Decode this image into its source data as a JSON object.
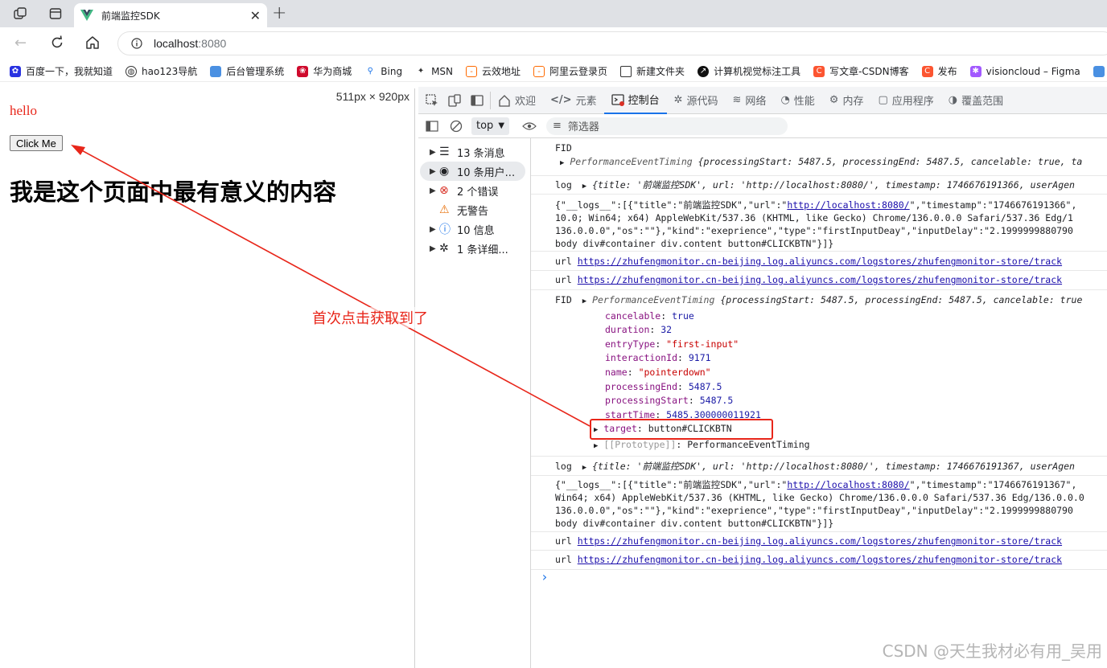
{
  "browser": {
    "tab_title": "前端监控SDK",
    "url_host": "localhost",
    "url_port": ":8080",
    "new_tab_label": "+",
    "viewport_size": "511px × 920px"
  },
  "bookmarks": [
    {
      "label": "百度一下，我就知道",
      "color": "#2932e1",
      "icon": "paw-icon"
    },
    {
      "label": "hao123导航",
      "color": "#555",
      "icon": "globe-icon"
    },
    {
      "label": "后台管理系统",
      "color": "#4a90e2",
      "icon": "doc-icon"
    },
    {
      "label": "华为商城",
      "color": "#cf0a2c",
      "icon": "huawei-icon"
    },
    {
      "label": "Bing",
      "color": "#1a73e8",
      "icon": "search-icon"
    },
    {
      "label": "MSN",
      "color": "#333",
      "icon": "msn-icon"
    },
    {
      "label": "云效地址",
      "color": "#ff6a00",
      "icon": "aliyun-icon"
    },
    {
      "label": "阿里云登录页",
      "color": "#ff6a00",
      "icon": "aliyun-icon"
    },
    {
      "label": "新建文件夹",
      "color": "#555",
      "icon": "folder-icon"
    },
    {
      "label": "计算机视觉标注工具",
      "color": "#111",
      "icon": "arrow-icon"
    },
    {
      "label": "写文章-CSDN博客",
      "color": "#fc5531",
      "icon": "csdn-icon"
    },
    {
      "label": "发布",
      "color": "#fc5531",
      "icon": "csdn-icon"
    },
    {
      "label": "visioncloud – Figma",
      "color": "#a259ff",
      "icon": "figma-icon"
    }
  ],
  "page": {
    "hello": "hello",
    "button_label": "Click Me",
    "heading": "我是这个页面中最有意义的内容",
    "annotation": "首次点击获取到了"
  },
  "devtools": {
    "tabs": [
      "欢迎",
      "元素",
      "控制台",
      "源代码",
      "网络",
      "性能",
      "内存",
      "应用程序",
      "覆盖范围"
    ],
    "active_tab": "控制台",
    "context": "top",
    "filter_placeholder": "筛选器",
    "sidebar": [
      {
        "label": "13 条消息",
        "icon": "list-icon"
      },
      {
        "label": "10 条用户...",
        "icon": "user-icon"
      },
      {
        "label": "2 个错误",
        "icon": "error-icon"
      },
      {
        "label": "无警告",
        "icon": "warning-icon"
      },
      {
        "label": "10 信息",
        "icon": "info-icon"
      },
      {
        "label": "1 条详细...",
        "icon": "bug-icon"
      }
    ]
  },
  "console": {
    "fid": "FID",
    "pet": "PerformanceEventTiming",
    "pet_summary": "{processingStart: 5487.5, processingEnd: 5487.5, cancelable: true, ta",
    "pet_summary2": "{processingStart: 5487.5, processingEnd: 5487.5, cancelable: true",
    "log": "log",
    "log_obj1": "{title: '前端监控SDK', url: 'http://localhost:8080/', timestamp: 1746676191366, userAgen",
    "log_obj2": "{title: '前端监控SDK', url: 'http://localhost:8080/', timestamp: 1746676191367, userAgen",
    "json1_a": "{\"__logs__\":[{\"title\":\"前端监控SDK\",\"url\":\"",
    "json_url": "http://localhost:8080/",
    "json1_b": "\",\"timestamp\":\"1746676191366\",",
    "json1_l2": "10.0; Win64; x64) AppleWebKit/537.36 (KHTML, like Gecko) Chrome/136.0.0.0 Safari/537.36 Edg/1",
    "json1_l3": "136.0.0.0\",\"os\":\"\"},\"kind\":\"exeprience\",\"type\":\"firstInputDeay\",\"inputDelay\":\"2.1999999880790",
    "json_l4": "body div#container div.content button#CLICKBTN\"}]}",
    "json2_b": "\",\"timestamp\":\"1746676191367\",",
    "json2_l2": "Win64; x64) AppleWebKit/537.36 (KHTML, like Gecko) Chrome/136.0.0.0 Safari/537.36 Edg/136.0.0.0",
    "json2_l3": "136.0.0.0\",\"os\":\"\"},\"kind\":\"exeprience\",\"type\":\"firstInputDeay\",\"inputDelay\":\"2.1999999880790",
    "url_label": "url",
    "track_url": "https://zhufengmonitor.cn-beijing.log.aliyuncs.com/logstores/zhufengmonitor-store/track",
    "props": [
      {
        "k": "cancelable",
        "v": "true",
        "t": "n"
      },
      {
        "k": "duration",
        "v": "32",
        "t": "n"
      },
      {
        "k": "entryType",
        "v": "\"first-input\"",
        "t": "s"
      },
      {
        "k": "interactionId",
        "v": "9171",
        "t": "n"
      },
      {
        "k": "name",
        "v": "\"pointerdown\"",
        "t": "s"
      },
      {
        "k": "processingEnd",
        "v": "5487.5",
        "t": "n"
      },
      {
        "k": "processingStart",
        "v": "5487.5",
        "t": "n"
      },
      {
        "k": "startTime",
        "v": "5485.300000011921",
        "t": "n"
      }
    ],
    "target_key": "target",
    "target_val": "button#CLICKBTN",
    "proto_key": "[[Prototype]]",
    "proto_val": "PerformanceEventTiming",
    "prompt": "›"
  },
  "watermark": "CSDN @天生我材必有用_吴用",
  "colors": {
    "accent": "#1a73e8",
    "annotation": "#e8261a",
    "error": "#d93025"
  }
}
